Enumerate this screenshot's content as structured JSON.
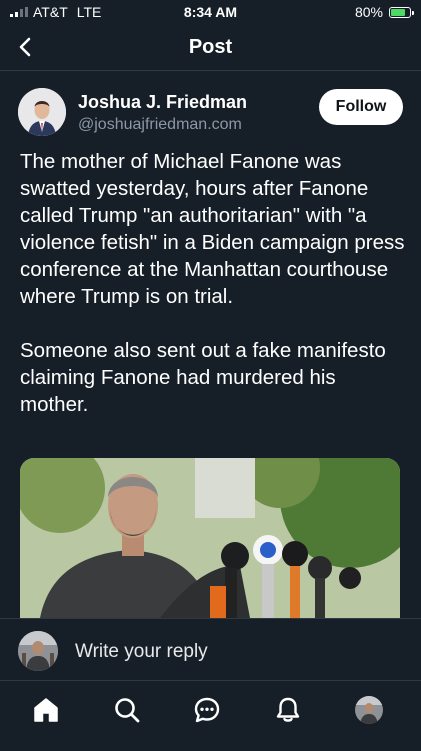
{
  "status": {
    "carrier": "AT&T",
    "network": "LTE",
    "time": "8:34 AM",
    "battery_percent": "80%",
    "battery_level": 0.8,
    "battery_color": "#4cd964"
  },
  "header": {
    "title": "Post",
    "back_icon": "chevron-left-icon"
  },
  "post": {
    "author_name": "Joshua J. Friedman",
    "author_handle": "@joshuajfriedman.com",
    "follow_label": "Follow",
    "paragraphs": [
      "The mother of Michael Fanone was swatted yesterday, hours after Fanone called Trump \"an authoritarian\" with \"a violence fetish\" in a Biden campaign press conference at the Manhattan courthouse where Trump is on trial.",
      "Someone also sent out a fake manifesto claiming Fanone had murdered his mother."
    ]
  },
  "reply": {
    "placeholder": "Write your reply"
  },
  "tabs": [
    {
      "icon": "home-icon"
    },
    {
      "icon": "search-icon"
    },
    {
      "icon": "chat-icon"
    },
    {
      "icon": "bell-icon"
    },
    {
      "icon": "profile-avatar"
    }
  ],
  "colors": {
    "background": "#161e27",
    "divider": "#2f3944",
    "secondary_text": "#8b98a5",
    "follow_bg": "#ffffff"
  }
}
